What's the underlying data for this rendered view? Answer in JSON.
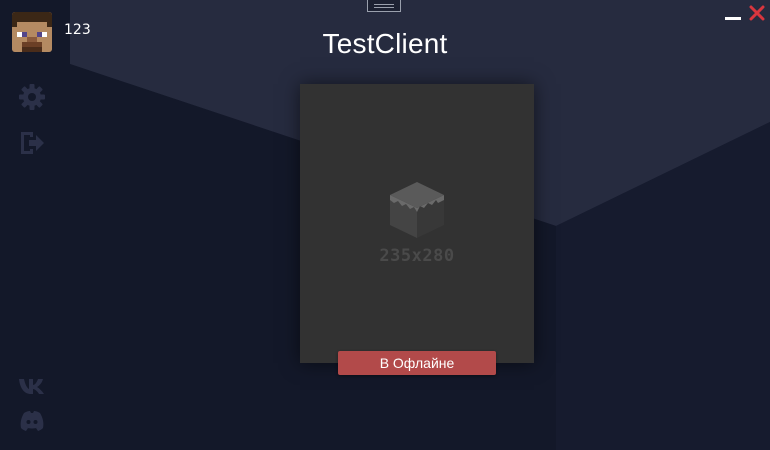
{
  "window": {
    "title": "TestClient",
    "minimize_icon": "minimize-icon",
    "close_icon": "close-icon",
    "close_color": "#d9363e"
  },
  "user": {
    "name": "123",
    "avatar_icon": "player-head-avatar"
  },
  "sidebar": {
    "top_items": [
      {
        "icon": "gear-icon"
      },
      {
        "icon": "logout-icon"
      }
    ],
    "bottom_items": [
      {
        "icon": "vk-icon"
      },
      {
        "icon": "discord-icon"
      }
    ]
  },
  "server_card": {
    "image_icon": "block-icon",
    "placeholder_text": "235x280"
  },
  "actions": {
    "offline_label": "В Офлайне",
    "offline_color": "#b24a4a"
  },
  "colors": {
    "background": "#161b2e",
    "panel_light": "#262b3f",
    "card": "#323232"
  }
}
